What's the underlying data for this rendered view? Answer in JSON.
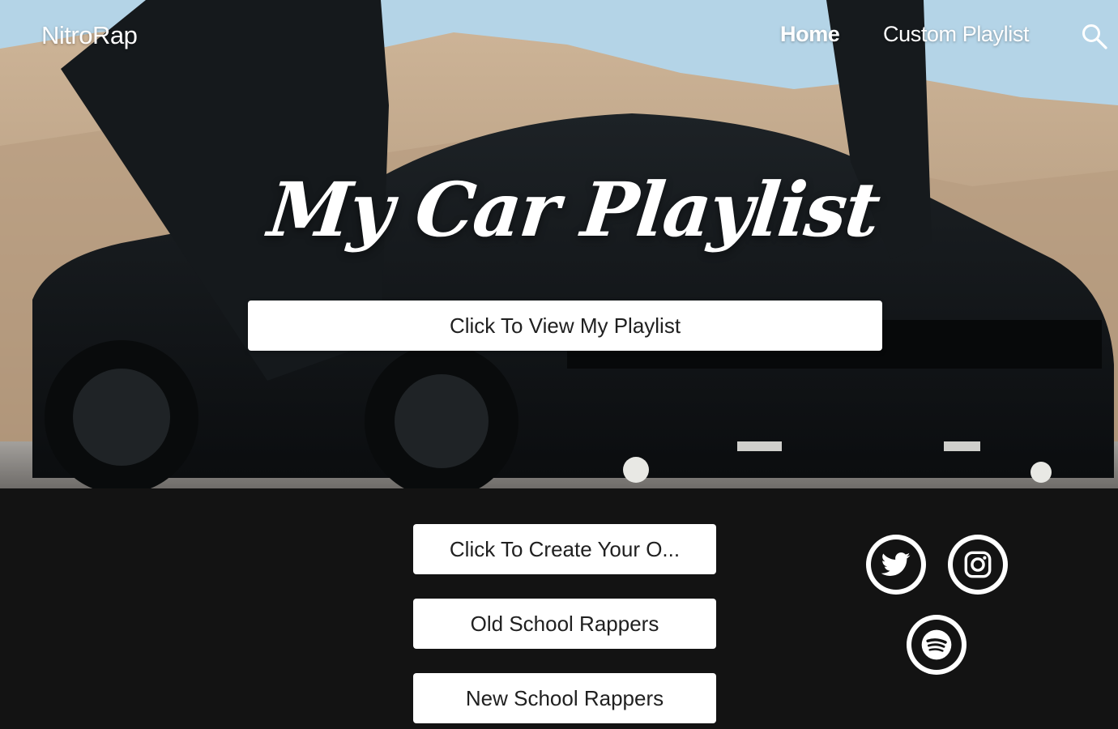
{
  "header": {
    "brand": "NitroRap",
    "nav": [
      {
        "label": "Home",
        "active": true
      },
      {
        "label": "Custom Playlist",
        "active": false
      }
    ],
    "search_icon": "search-icon"
  },
  "hero": {
    "title": "My Car Playlist",
    "cta_label": "Click To View My Playlist"
  },
  "links": {
    "create_label": "Click To Create Your O...",
    "old_school_label": "Old School Rappers",
    "new_school_label": "New School Rappers"
  },
  "social": [
    {
      "icon": "twitter-icon"
    },
    {
      "icon": "instagram-icon"
    },
    {
      "icon": "spotify-icon"
    }
  ],
  "colors": {
    "footer_bg": "#131313",
    "button_bg": "#ffffff",
    "text_light": "#ffffff"
  }
}
